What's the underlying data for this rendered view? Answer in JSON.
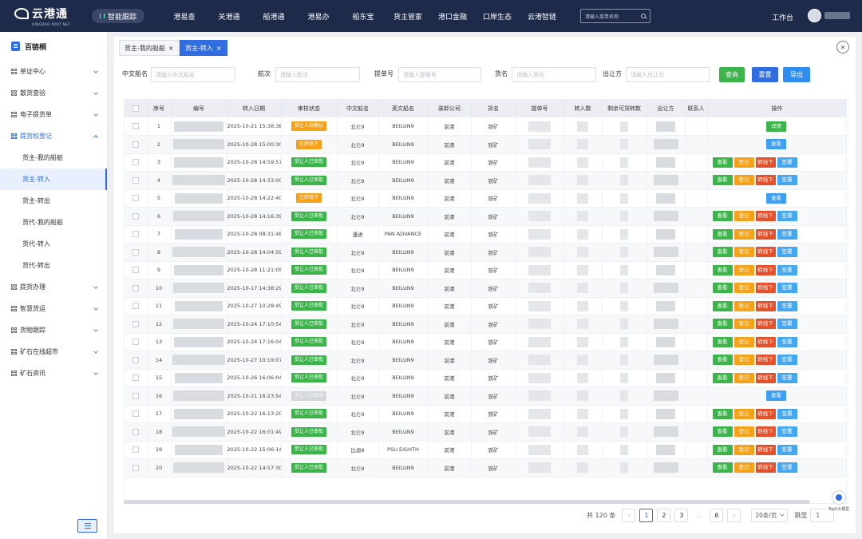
{
  "brand": {
    "name": "云港通",
    "sub": "QINGDAO PORT NET"
  },
  "topnav": {
    "pill": "智能跟踪",
    "items": [
      "港易查",
      "关港通",
      "船港通",
      "港易办",
      "船东宝",
      "货主管家",
      "港口金融",
      "口岸生态",
      "云港智链"
    ],
    "search_placeholder": "请输入菜单名称",
    "workbench": "工作台"
  },
  "sidebar": {
    "title": "百链桐",
    "menu": [
      {
        "label": "单证中心",
        "expanded": false
      },
      {
        "label": "散货查验",
        "expanded": false
      },
      {
        "label": "电子提货单",
        "expanded": false
      },
      {
        "label": "提货权登记",
        "expanded": true,
        "children": [
          "货主-我的船舶",
          "货主-转入",
          "货主-转出",
          "货代-我的船舶",
          "货代-转入",
          "货代-转出"
        ]
      },
      {
        "label": "提货办理",
        "expanded": false
      },
      {
        "label": "智慧货运",
        "expanded": false
      },
      {
        "label": "货物跟踪",
        "expanded": false
      },
      {
        "label": "矿石在线超市",
        "expanded": false
      },
      {
        "label": "矿石资讯",
        "expanded": false
      }
    ],
    "collapse_label": "☰"
  },
  "tabs": [
    {
      "label": "货主-我的船舶",
      "close": "×"
    },
    {
      "label": "货主-转入",
      "close": "×"
    }
  ],
  "close_all": "✕",
  "filters": {
    "ship_cn": {
      "label": "中文船名",
      "placeholder": "请输入中文船名"
    },
    "voyage": {
      "label": "航次",
      "placeholder": "请输入航次"
    },
    "bill": {
      "label": "提单号",
      "placeholder": "请输入提单号"
    },
    "cargo": {
      "label": "货名",
      "placeholder": "请输入货名"
    },
    "shipper": {
      "label": "出让方",
      "placeholder": "请输入出让方"
    },
    "query": "查询",
    "reset": "重置",
    "export": "导出"
  },
  "table": {
    "columns": [
      "序号",
      "编号",
      "转入日期",
      "审核状态",
      "中文船名",
      "英文船名",
      "装卸公司",
      "货名",
      "提单号",
      "转入数",
      "剩余可货转数",
      "出让方",
      "联系人",
      "操作"
    ],
    "ops": {
      "view": "查看",
      "register": "登记",
      "offline": "转线下",
      "sign": "签署",
      "detail": "详情"
    },
    "rows": [
      {
        "seq": "1",
        "date": "2025-10-21 15:38:38",
        "status": "受让人待确认",
        "status_color": "orange",
        "ship_cn": "北仑9",
        "ship_en": "BEILUN9",
        "company": "前港",
        "cargo": "铁矿",
        "ops": "detail"
      },
      {
        "seq": "2",
        "date": "2025-10-28 15:00:30",
        "status": "已转线下",
        "status_color": "orange",
        "ship_cn": "北仑9",
        "ship_en": "BEILUN9",
        "company": "前港",
        "cargo": "铁矿",
        "ops": "view"
      },
      {
        "seq": "3",
        "date": "2025-10-28 14:59:57",
        "status": "受让人已审批",
        "status_color": "green",
        "ship_cn": "北仑9",
        "ship_en": "BEILUN9",
        "company": "前港",
        "cargo": "铁矿",
        "ops": "full"
      },
      {
        "seq": "4",
        "date": "2025-10-28 14:33:00",
        "status": "受让人已审批",
        "status_color": "green",
        "ship_cn": "北仑9",
        "ship_en": "BEILUN9",
        "company": "前港",
        "cargo": "铁矿",
        "ops": "full"
      },
      {
        "seq": "5",
        "date": "2025-10-28 14:22:40",
        "status": "已转线下",
        "status_color": "orange",
        "ship_cn": "北仑9",
        "ship_en": "BEILUN9",
        "company": "前港",
        "cargo": "铁矿",
        "ops": "view"
      },
      {
        "seq": "6",
        "date": "2025-10-28 14:16:39",
        "status": "受让人已审批",
        "status_color": "green",
        "ship_cn": "北仑9",
        "ship_en": "BEILUN9",
        "company": "前港",
        "cargo": "铁矿",
        "ops": "full"
      },
      {
        "seq": "7",
        "date": "2025-10-28 08:31:48",
        "status": "受让人已审批",
        "status_color": "green",
        "ship_cn": "潘进",
        "ship_en": "PAN ADVANCE",
        "company": "前港",
        "cargo": "铁矿",
        "ops": "full"
      },
      {
        "seq": "8",
        "date": "2025-10-28 14:04:59",
        "status": "受让人已审批",
        "status_color": "green",
        "ship_cn": "北仑9",
        "ship_en": "BEILUN9",
        "company": "前港",
        "cargo": "铁矿",
        "ops": "full"
      },
      {
        "seq": "9",
        "date": "2025-10-28 11:21:05",
        "status": "受让人已审批",
        "status_color": "green",
        "ship_cn": "北仑9",
        "ship_en": "BEILUN9",
        "company": "前港",
        "cargo": "铁矿",
        "ops": "full"
      },
      {
        "seq": "10",
        "date": "2025-10-17 14:38:29",
        "status": "受让人已审批",
        "status_color": "green",
        "ship_cn": "北仑9",
        "ship_en": "BEILUN9",
        "company": "前港",
        "cargo": "铁矿",
        "ops": "full"
      },
      {
        "seq": "11",
        "date": "2025-10-27 10:28:49",
        "status": "受让人已审批",
        "status_color": "green",
        "ship_cn": "北仑9",
        "ship_en": "BEILUN9",
        "company": "前港",
        "cargo": "铁矿",
        "ops": "full"
      },
      {
        "seq": "12",
        "date": "2025-10-24 17:10:54",
        "status": "受让人已审批",
        "status_color": "green",
        "ship_cn": "北仑9",
        "ship_en": "BEILUN9",
        "company": "前港",
        "cargo": "铁矿",
        "ops": "full"
      },
      {
        "seq": "13",
        "date": "2025-10-24 17:16:04",
        "status": "受让人已审批",
        "status_color": "green",
        "ship_cn": "北仑9",
        "ship_en": "BEILUN9",
        "company": "前港",
        "cargo": "铁矿",
        "ops": "full"
      },
      {
        "seq": "14",
        "date": "2025-10-27 10:19:07",
        "status": "受让人已审批",
        "status_color": "green",
        "ship_cn": "北仑9",
        "ship_en": "BEILUN9",
        "company": "前港",
        "cargo": "铁矿",
        "ops": "full"
      },
      {
        "seq": "15",
        "date": "2025-10-26 16:06:04",
        "status": "受让人已审批",
        "status_color": "green",
        "ship_cn": "北仑9",
        "ship_en": "BEILUN9",
        "company": "前港",
        "cargo": "铁矿",
        "ops": "full"
      },
      {
        "seq": "16",
        "date": "2025-10-21 16:23:54",
        "status": "受让人已驳回",
        "status_color": "gray",
        "ship_cn": "北仑9",
        "ship_en": "BEILUN9",
        "company": "前港",
        "cargo": "铁矿",
        "ops": "view"
      },
      {
        "seq": "17",
        "date": "2025-10-22 16:13:20",
        "status": "受让人已审批",
        "status_color": "green",
        "ship_cn": "北仑9",
        "ship_en": "BEILUN9",
        "company": "前港",
        "cargo": "铁矿",
        "ops": "full"
      },
      {
        "seq": "18",
        "date": "2025-10-22 16:01:49",
        "status": "受让人已审批",
        "status_color": "green",
        "ship_cn": "北仑9",
        "ship_en": "BEILUN9",
        "company": "前港",
        "cargo": "铁矿",
        "ops": "full"
      },
      {
        "seq": "19",
        "date": "2025-10-22 15:06:14",
        "status": "受让人已审批",
        "status_color": "green",
        "ship_cn": "比迪8",
        "ship_en": "PSU EIGHTH",
        "company": "前港",
        "cargo": "铁矿",
        "ops": "full"
      },
      {
        "seq": "20",
        "date": "2025-10-22 14:57:30",
        "status": "受让人已审批",
        "status_color": "green",
        "ship_cn": "北仑9",
        "ship_en": "BEILUN9",
        "company": "前港",
        "cargo": "铁矿",
        "ops": "full"
      }
    ]
  },
  "pagination": {
    "total": "共 120 条",
    "pages": [
      "1",
      "2",
      "3",
      "...",
      "6"
    ],
    "current": "1",
    "prev": "‹",
    "next": "›",
    "page_size": "20条/页",
    "jump_label": "跳至",
    "jump_value": "1"
  },
  "assistant": {
    "label": "TopS大模型"
  },
  "colors": {
    "nav": "#1e2a4a",
    "primary": "#2f6de1",
    "green": "#3bb54a",
    "orange": "#f5a11a",
    "red": "#e4502a"
  }
}
